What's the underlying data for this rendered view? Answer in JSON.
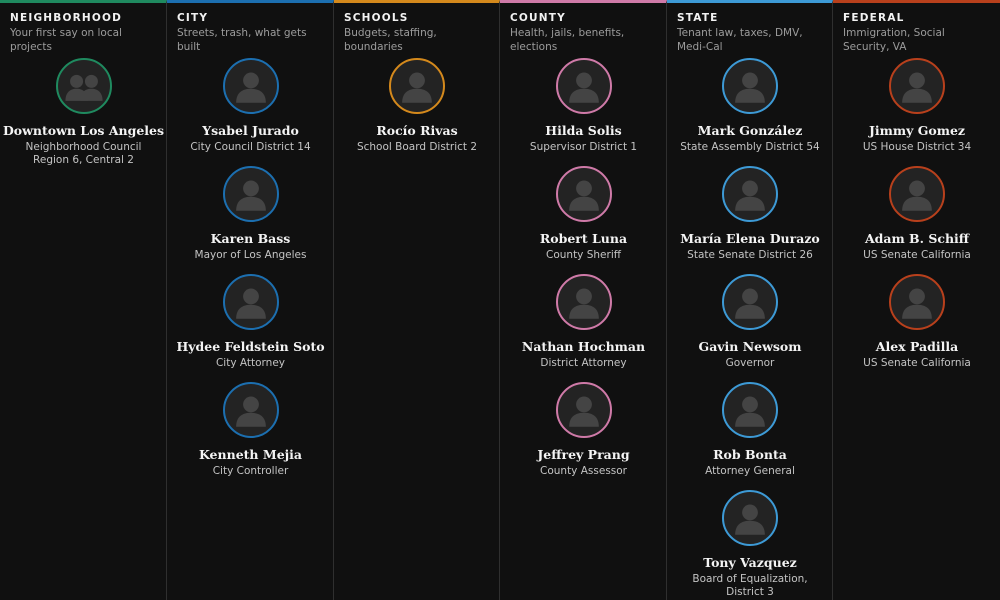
{
  "columns": [
    {
      "title": "Neighborhood",
      "description": "Your first say on local projects",
      "accent": "#1f8a5f",
      "people": [
        {
          "name": "Downtown Los Angeles",
          "role": "Neighborhood Council Region 6, Central 2",
          "icon": "group-icon"
        }
      ]
    },
    {
      "title": "City",
      "description": "Streets, trash, what gets built",
      "accent": "#1c6fb0",
      "people": [
        {
          "name": "Ysabel Jurado",
          "role": "City Council District 14",
          "icon": "person-icon"
        },
        {
          "name": "Karen Bass",
          "role": "Mayor of Los Angeles",
          "icon": "person-icon"
        },
        {
          "name": "Hydee Feldstein Soto",
          "role": "City Attorney",
          "icon": "person-icon"
        },
        {
          "name": "Kenneth Mejia",
          "role": "City Controller",
          "icon": "person-icon"
        }
      ]
    },
    {
      "title": "Schools",
      "description": "Budgets, staffing, boundaries",
      "accent": "#d4891c",
      "people": [
        {
          "name": "Rocío Rivas",
          "role": "School Board District 2",
          "icon": "person-icon"
        }
      ]
    },
    {
      "title": "County",
      "description": "Health, jails, benefits, elections",
      "accent": "#cf7aa8",
      "people": [
        {
          "name": "Hilda Solis",
          "role": "Supervisor District 1",
          "icon": "person-icon"
        },
        {
          "name": "Robert Luna",
          "role": "County Sheriff",
          "icon": "person-icon"
        },
        {
          "name": "Nathan Hochman",
          "role": "District Attorney",
          "icon": "person-icon"
        },
        {
          "name": "Jeffrey Prang",
          "role": "County Assessor",
          "icon": "person-icon"
        }
      ]
    },
    {
      "title": "State",
      "description": "Tenant law, taxes, DMV, Medi-Cal",
      "accent": "#3d9ad6",
      "people": [
        {
          "name": "Mark González",
          "role": "State Assembly District 54",
          "icon": "person-icon"
        },
        {
          "name": "María Elena Durazo",
          "role": "State Senate District 26",
          "icon": "person-icon"
        },
        {
          "name": "Gavin Newsom",
          "role": "Governor",
          "icon": "person-icon"
        },
        {
          "name": "Rob Bonta",
          "role": "Attorney General",
          "icon": "person-icon"
        },
        {
          "name": "Tony Vazquez",
          "role": "Board of Equalization, District 3",
          "icon": "person-icon"
        }
      ]
    },
    {
      "title": "Federal",
      "description": "Immigration, Social Security, VA",
      "accent": "#b8401c",
      "people": [
        {
          "name": "Jimmy Gomez",
          "role": "US House District 34",
          "icon": "person-icon"
        },
        {
          "name": "Adam B. Schiff",
          "role": "US Senate California",
          "icon": "person-icon"
        },
        {
          "name": "Alex Padilla",
          "role": "US Senate California",
          "icon": "person-icon"
        }
      ]
    }
  ]
}
